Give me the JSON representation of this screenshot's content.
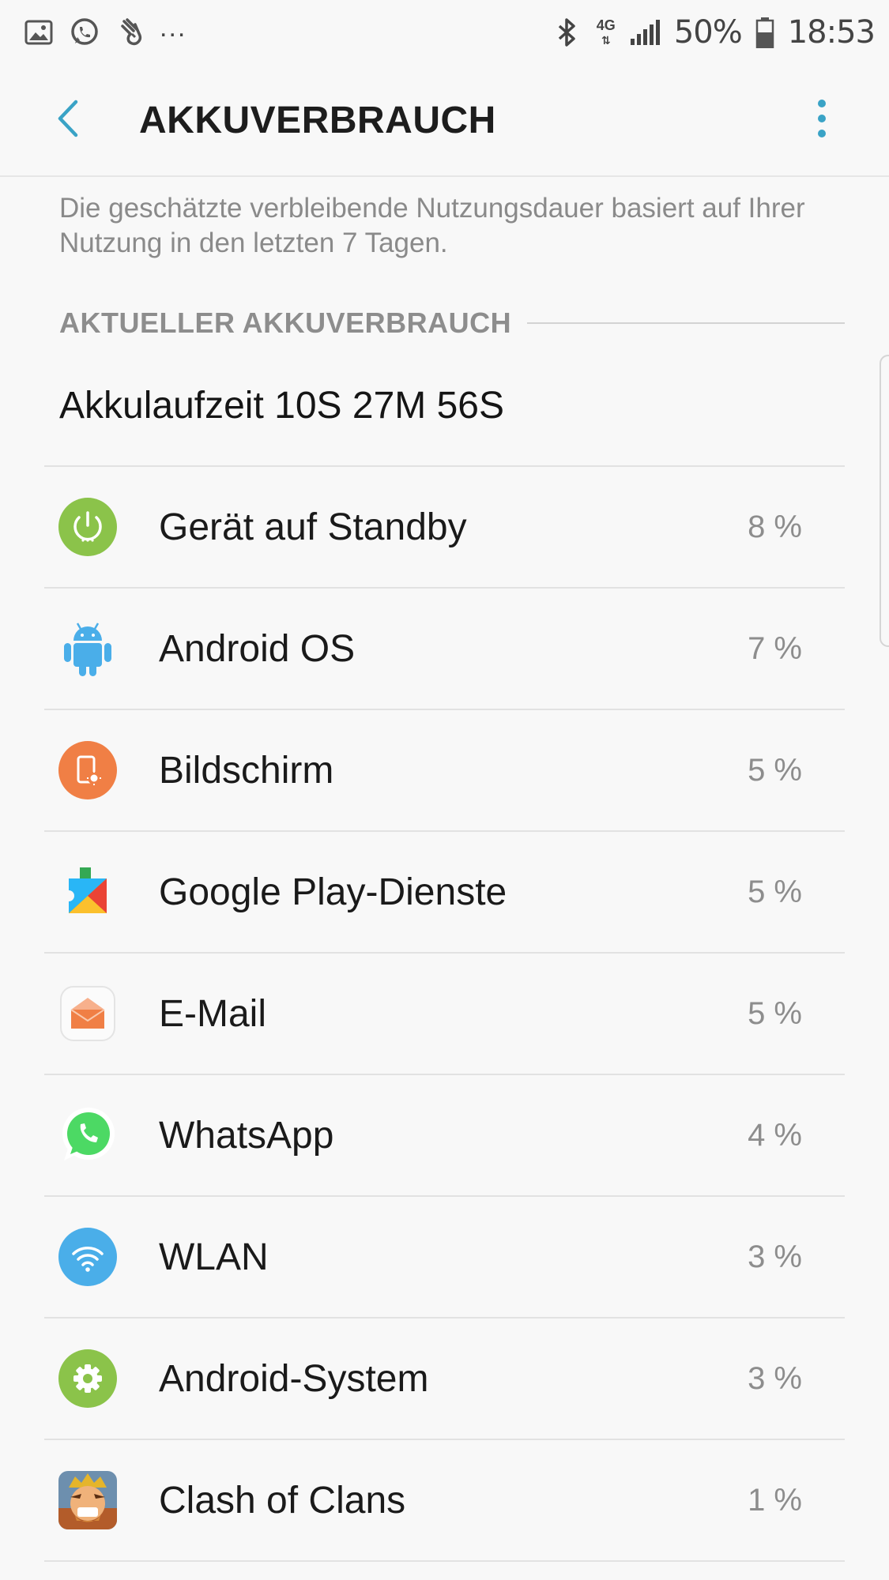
{
  "status_bar": {
    "icons_left": [
      "gallery-icon",
      "whatsapp-notification-icon",
      "hand-icon"
    ],
    "more_indicator": "...",
    "network_label_top": "4G",
    "battery_percent": "50%",
    "time": "18:53"
  },
  "appbar": {
    "title": "AKKUVERBRAUCH",
    "back_icon": "chevron-left-icon",
    "more_icon": "more-vertical-icon"
  },
  "info_text": "Die geschätzte verbleibende Nutzungsdauer basiert auf Ihrer Nutzung in den letzten 7 Tagen.",
  "section": {
    "title": "AKTUELLER AKKUVERBRAUCH"
  },
  "runtime": "Akkulaufzeit 10S 27M 56S",
  "items": [
    {
      "label": "Gerät auf Standby",
      "percent": "8 %",
      "icon": "standby-icon",
      "icon_color": "#8bc34a"
    },
    {
      "label": "Android OS",
      "percent": "7 %",
      "icon": "android-icon",
      "icon_color": "#4aaee9"
    },
    {
      "label": "Bildschirm",
      "percent": "5 %",
      "icon": "screen-brightness-icon",
      "icon_color": "#f07f45"
    },
    {
      "label": "Google Play-Dienste",
      "percent": "5 %",
      "icon": "google-play-services-icon",
      "icon_color": "#34a853"
    },
    {
      "label": "E-Mail",
      "percent": "5 %",
      "icon": "email-icon",
      "icon_color": "#f07f45"
    },
    {
      "label": "WhatsApp",
      "percent": "4 %",
      "icon": "whatsapp-icon",
      "icon_color": "#4cd964"
    },
    {
      "label": "WLAN",
      "percent": "3 %",
      "icon": "wifi-icon",
      "icon_color": "#4aaee9"
    },
    {
      "label": "Android-System",
      "percent": "3 %",
      "icon": "settings-gear-icon",
      "icon_color": "#8bc34a"
    },
    {
      "label": "Clash of Clans",
      "percent": "1 %",
      "icon": "clash-of-clans-icon",
      "icon_color": "#c68a2f"
    }
  ],
  "colors": {
    "accent": "#3aa3c6",
    "background": "#f8f8f8",
    "divider": "#e2e2e2"
  }
}
